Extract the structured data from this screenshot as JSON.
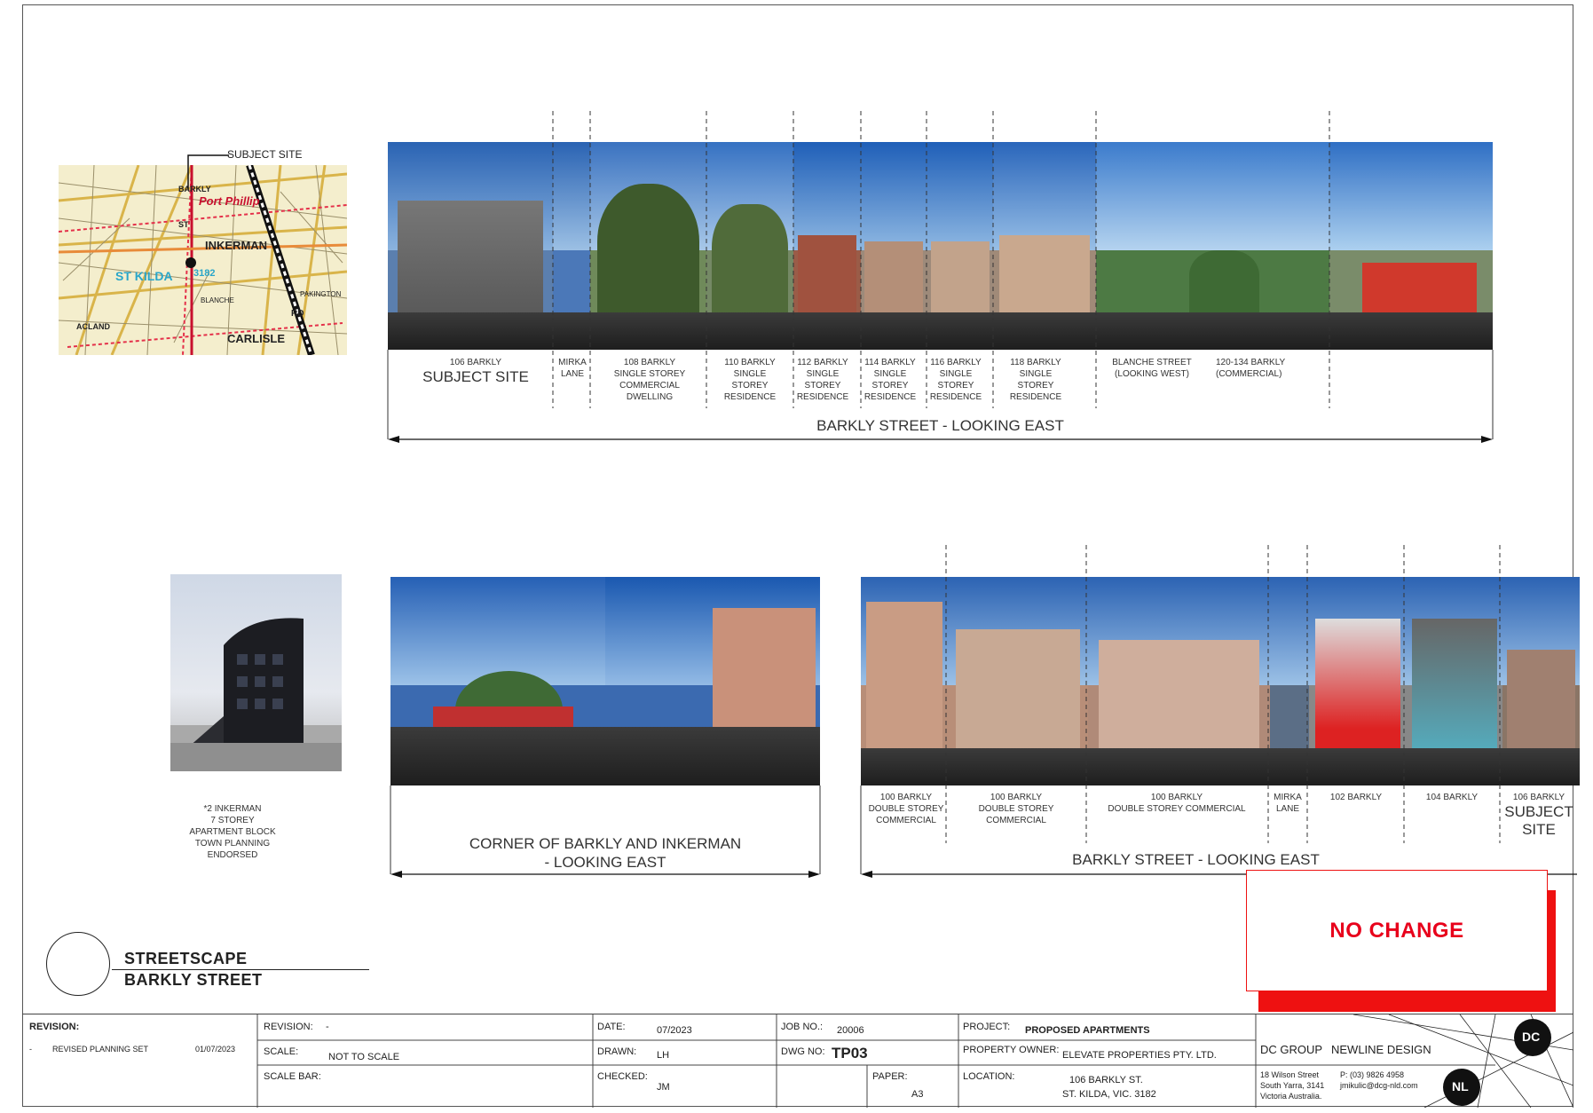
{
  "keymap": {
    "subject_site_label": "SUBJECT SITE",
    "labels": [
      "Port Phillip",
      "INKERMAN",
      "ST KILDA",
      "3182",
      "CARLISLE",
      "ST",
      "RD",
      "BARKLY",
      "ACLAND",
      "BLANCHE",
      "PAKINGTON"
    ]
  },
  "top_strip": {
    "caption": "BARKLY STREET  - LOOKING EAST",
    "segments": [
      {
        "lines": [
          "106 BARKLY"
        ],
        "big": "SUBJECT SITE"
      },
      {
        "lines": [
          "MIRKA",
          "LANE"
        ]
      },
      {
        "lines": [
          "108 BARKLY",
          "SINGLE STOREY",
          "COMMERCIAL",
          "DWELLING"
        ]
      },
      {
        "lines": [
          "110 BARKLY",
          "SINGLE",
          "STOREY",
          "RESIDENCE"
        ]
      },
      {
        "lines": [
          "112 BARKLY",
          "SINGLE",
          "STOREY",
          "RESIDENCE"
        ]
      },
      {
        "lines": [
          "114 BARKLY",
          "SINGLE",
          "STOREY",
          "RESIDENCE"
        ]
      },
      {
        "lines": [
          "116 BARKLY",
          "SINGLE",
          "STOREY",
          "RESIDENCE"
        ]
      },
      {
        "lines": [
          "118 BARKLY",
          "SINGLE",
          "STOREY",
          "RESIDENCE"
        ]
      },
      {
        "lines": [
          "BLANCHE STREET",
          "(LOOKING WEST)"
        ]
      },
      {
        "lines": [
          "120-134 BARKLY",
          "(COMMERCIAL)"
        ]
      }
    ]
  },
  "render": {
    "lines": [
      "*2 INKERMAN",
      "7 STOREY",
      "APARTMENT BLOCK",
      "TOWN PLANNING",
      "ENDORSED"
    ]
  },
  "corner_strip": {
    "caption_lines": [
      "CORNER OF BARKLY AND INKERMAN",
      "- LOOKING EAST"
    ]
  },
  "bottom_strip": {
    "caption": "BARKLY STREET - LOOKING EAST",
    "segments": [
      {
        "lines": [
          "100 BARKLY",
          "DOUBLE STOREY",
          "COMMERCIAL"
        ]
      },
      {
        "lines": [
          "100 BARKLY",
          "DOUBLE STOREY",
          "COMMERCIAL"
        ]
      },
      {
        "lines": [
          "100 BARKLY",
          "DOUBLE STOREY COMMERCIAL"
        ]
      },
      {
        "lines": [
          "MIRKA",
          "LANE"
        ]
      },
      {
        "lines": [
          "102 BARKLY"
        ]
      },
      {
        "lines": [
          "104 BARKLY"
        ]
      },
      {
        "lines": [
          "106 BARKLY"
        ],
        "big": [
          "SUBJECT",
          "SITE"
        ]
      }
    ]
  },
  "title": {
    "line1": "STREETSCAPE",
    "line2": "BARKLY STREET"
  },
  "stamp": "NO CHANGE",
  "title_block": {
    "revision_header": "REVISION:",
    "revision_row": {
      "dash": "-",
      "text": "REVISED PLANNING SET",
      "date": "01/07/2023"
    },
    "revision_label": "REVISION:",
    "revision_value": "-",
    "scale_label": "SCALE:",
    "scale_value": "NOT TO SCALE",
    "scale_bar_label": "SCALE BAR:",
    "date_label": "DATE:",
    "date_value": "07/2023",
    "drawn_label": "DRAWN:",
    "drawn_value": "LH",
    "checked_label": "CHECKED:",
    "checked_value": "JM",
    "job_label": "JOB NO.:",
    "job_value": "20006",
    "dwg_label": "DWG NO:",
    "dwg_value": "TP03",
    "paper_label": "PAPER:",
    "paper_value": "A3",
    "project_label": "PROJECT:",
    "project_value": "PROPOSED APARTMENTS",
    "owner_label": "PROPERTY OWNER:",
    "owner_value": "ELEVATE PROPERTIES PTY. LTD.",
    "location_label": "LOCATION:",
    "location_line1": "106 BARKLY ST.",
    "location_line2": "ST. KILDA, VIC. 3182",
    "company1": "DC GROUP",
    "company2": "NEWLINE DESIGN",
    "address_lines": [
      "18 Wilson Street",
      "South Yarra, 3141",
      "Victoria Australia."
    ],
    "contact_lines": [
      "P: (03) 9826 4958",
      "jmikulic@dcg-nld.com"
    ],
    "logo_dc": "DC",
    "logo_nl": "NL"
  }
}
